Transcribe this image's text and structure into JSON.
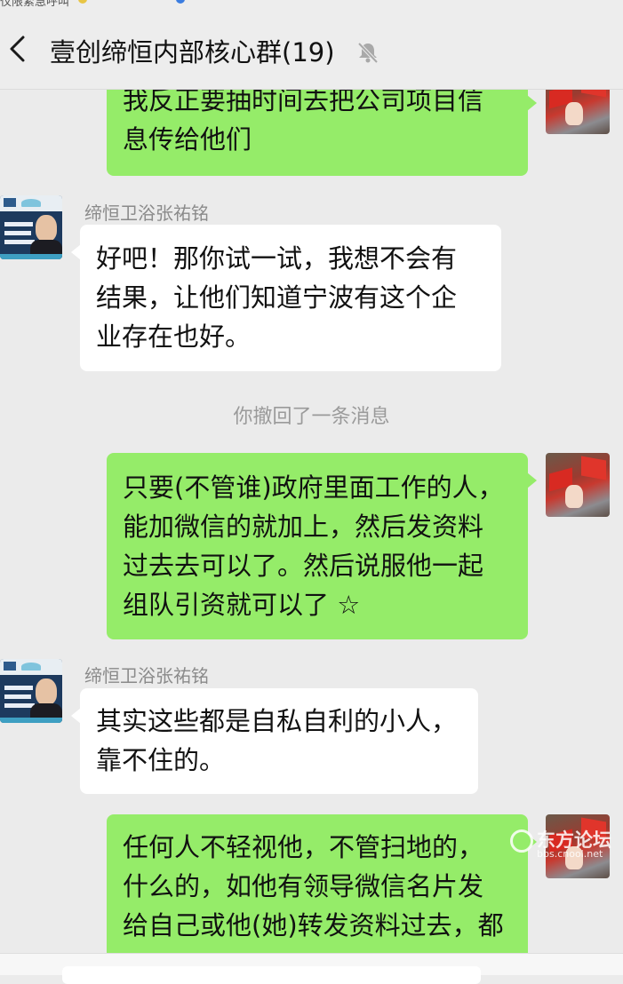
{
  "status_bar": {
    "text": "仅限紧急呼叫"
  },
  "header": {
    "title": "壹创缔恒内部核心群(19)"
  },
  "messages": [
    {
      "lines": [
        "我反正要抽时间去把公司项目信",
        "息传给他们"
      ]
    },
    {
      "sender": "缔恒卫浴张祐铭",
      "lines": [
        "好吧！那你试一试，我想不会有",
        "结果，让他们知道宁波有这个企",
        "业存在也好。"
      ]
    },
    {
      "system": "你撤回了一条消息"
    },
    {
      "lines": [
        "只要(不管谁)政府里面工作的人，",
        "能加微信的就加上，然后发资料",
        "过去去可以了。然后说服他一起",
        "组队引资就可以了 ☆"
      ]
    },
    {
      "sender": "缔恒卫浴张祐铭",
      "lines": [
        "其实这些都是自私自利的小人，",
        "靠不住的。"
      ]
    },
    {
      "lines": [
        "任何人不轻视他，不管扫地的，",
        "什么的，如他有领导微信名片发",
        "给自己或他(她)转发资料过去，都"
      ]
    }
  ],
  "watermark": {
    "name": "东方论坛",
    "url": "bbs.cnool.net"
  },
  "colors": {
    "bubble_self": "#95ec69",
    "bubble_other": "#ffffff",
    "background": "#ebebeb",
    "header_bg": "#ededed"
  }
}
